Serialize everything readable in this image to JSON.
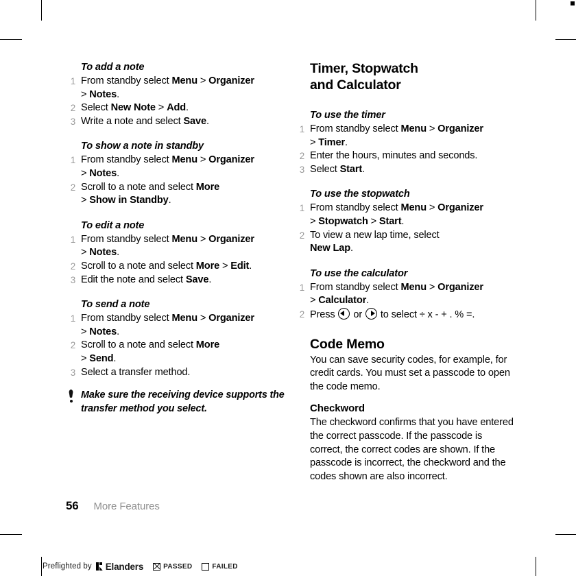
{
  "document": {
    "page_number": "56",
    "running_head": "More Features"
  },
  "left_column": {
    "sections": [
      {
        "heading": "To add a note",
        "steps": [
          {
            "num": "1",
            "parts": [
              {
                "t": "From standby select ",
                "b": false
              },
              {
                "t": "Menu",
                "b": true
              },
              {
                "t": " > ",
                "b": false
              },
              {
                "t": "Organizer",
                "b": true
              },
              {
                "t": "\n> ",
                "b": false
              },
              {
                "t": "Notes",
                "b": true
              },
              {
                "t": ".",
                "b": false
              }
            ]
          },
          {
            "num": "2",
            "parts": [
              {
                "t": "Select ",
                "b": false
              },
              {
                "t": "New Note",
                "b": true
              },
              {
                "t": " > ",
                "b": false
              },
              {
                "t": "Add",
                "b": true
              },
              {
                "t": ".",
                "b": false
              }
            ]
          },
          {
            "num": "3",
            "parts": [
              {
                "t": "Write a note and select ",
                "b": false
              },
              {
                "t": "Save",
                "b": true
              },
              {
                "t": ".",
                "b": false
              }
            ]
          }
        ]
      },
      {
        "heading": "To show a note in standby",
        "steps": [
          {
            "num": "1",
            "parts": [
              {
                "t": "From standby select ",
                "b": false
              },
              {
                "t": "Menu",
                "b": true
              },
              {
                "t": " > ",
                "b": false
              },
              {
                "t": "Organizer",
                "b": true
              },
              {
                "t": "\n> ",
                "b": false
              },
              {
                "t": "Notes",
                "b": true
              },
              {
                "t": ".",
                "b": false
              }
            ]
          },
          {
            "num": "2",
            "parts": [
              {
                "t": "Scroll to a note and select ",
                "b": false
              },
              {
                "t": "More",
                "b": true
              },
              {
                "t": "\n> ",
                "b": false
              },
              {
                "t": "Show in Standby",
                "b": true
              },
              {
                "t": ".",
                "b": false
              }
            ]
          }
        ]
      },
      {
        "heading": "To edit a note",
        "steps": [
          {
            "num": "1",
            "parts": [
              {
                "t": "From standby select ",
                "b": false
              },
              {
                "t": "Menu",
                "b": true
              },
              {
                "t": " > ",
                "b": false
              },
              {
                "t": "Organizer",
                "b": true
              },
              {
                "t": "\n> ",
                "b": false
              },
              {
                "t": "Notes",
                "b": true
              },
              {
                "t": ".",
                "b": false
              }
            ]
          },
          {
            "num": "2",
            "parts": [
              {
                "t": "Scroll to a note and select ",
                "b": false
              },
              {
                "t": "More",
                "b": true
              },
              {
                "t": " > ",
                "b": false
              },
              {
                "t": "Edit",
                "b": true
              },
              {
                "t": ".",
                "b": false
              }
            ]
          },
          {
            "num": "3",
            "parts": [
              {
                "t": "Edit the note and select ",
                "b": false
              },
              {
                "t": "Save",
                "b": true
              },
              {
                "t": ".",
                "b": false
              }
            ]
          }
        ]
      },
      {
        "heading": "To send a note",
        "steps": [
          {
            "num": "1",
            "parts": [
              {
                "t": "From standby select ",
                "b": false
              },
              {
                "t": "Menu",
                "b": true
              },
              {
                "t": " > ",
                "b": false
              },
              {
                "t": "Organizer",
                "b": true
              },
              {
                "t": "\n> ",
                "b": false
              },
              {
                "t": "Notes",
                "b": true
              },
              {
                "t": ".",
                "b": false
              }
            ]
          },
          {
            "num": "2",
            "parts": [
              {
                "t": "Scroll to a note and select ",
                "b": false
              },
              {
                "t": "More",
                "b": true
              },
              {
                "t": "\n> ",
                "b": false
              },
              {
                "t": "Send",
                "b": true
              },
              {
                "t": ".",
                "b": false
              }
            ]
          },
          {
            "num": "3",
            "parts": [
              {
                "t": "Select a transfer method.",
                "b": false
              }
            ]
          }
        ]
      }
    ],
    "tip": {
      "icon": "exclamation-mark-icon",
      "text": "Make sure the receiving device supports the transfer method you select."
    }
  },
  "right_column": {
    "title": "Timer, Stopwatch\nand Calculator",
    "sections": [
      {
        "heading": "To use the timer",
        "steps": [
          {
            "num": "1",
            "parts": [
              {
                "t": "From standby select ",
                "b": false
              },
              {
                "t": "Menu",
                "b": true
              },
              {
                "t": " > ",
                "b": false
              },
              {
                "t": "Organizer",
                "b": true
              },
              {
                "t": "\n> ",
                "b": false
              },
              {
                "t": "Timer",
                "b": true
              },
              {
                "t": ".",
                "b": false
              }
            ]
          },
          {
            "num": "2",
            "parts": [
              {
                "t": "Enter the hours, minutes and seconds.",
                "b": false
              }
            ]
          },
          {
            "num": "3",
            "parts": [
              {
                "t": "Select ",
                "b": false
              },
              {
                "t": "Start",
                "b": true
              },
              {
                "t": ".",
                "b": false
              }
            ]
          }
        ]
      },
      {
        "heading": "To use the stopwatch",
        "steps": [
          {
            "num": "1",
            "parts": [
              {
                "t": "From standby select ",
                "b": false
              },
              {
                "t": "Menu",
                "b": true
              },
              {
                "t": " > ",
                "b": false
              },
              {
                "t": "Organizer",
                "b": true
              },
              {
                "t": "\n> ",
                "b": false
              },
              {
                "t": "Stopwatch",
                "b": true
              },
              {
                "t": " > ",
                "b": false
              },
              {
                "t": "Start",
                "b": true
              },
              {
                "t": ".",
                "b": false
              }
            ]
          },
          {
            "num": "2",
            "parts": [
              {
                "t": "To view a new lap time, select\n",
                "b": false
              },
              {
                "t": "New Lap",
                "b": true
              },
              {
                "t": ".",
                "b": false
              }
            ]
          }
        ]
      },
      {
        "heading": "To use the calculator",
        "steps": [
          {
            "num": "1",
            "parts": [
              {
                "t": "From standby select ",
                "b": false
              },
              {
                "t": "Menu",
                "b": true
              },
              {
                "t": " > ",
                "b": false
              },
              {
                "t": "Organizer",
                "b": true
              },
              {
                "t": "\n> ",
                "b": false
              },
              {
                "t": "Calculator",
                "b": true
              },
              {
                "t": ".",
                "b": false
              }
            ]
          }
        ],
        "calculator_step": {
          "num": "2",
          "before": "Press ",
          "icon_left": "nav-key-left-icon",
          "middle": " or ",
          "icon_right": "nav-key-right-icon",
          "after": " to select ÷ x - + . % =."
        }
      }
    ],
    "code_memo": {
      "heading": "Code Memo",
      "body": "You can save security codes, for example, for credit cards. You must set a passcode to open the code memo.",
      "subheading": "Checkword",
      "subbody": "The checkword confirms that you have entered the correct passcode. If the passcode is correct, the correct codes are shown. If the passcode is incorrect, the checkword and the codes shown are also incorrect."
    }
  },
  "preflight": {
    "prefix": "Preflighted by",
    "brand": "Elanders",
    "passed_label": "PASSED",
    "failed_label": "FAILED",
    "passed_checked": true,
    "failed_checked": false
  },
  "colors": {
    "text": "#000000",
    "step_number": "#9a9a9a",
    "running_head": "#8e8e8e",
    "page_background": "#ffffff"
  }
}
